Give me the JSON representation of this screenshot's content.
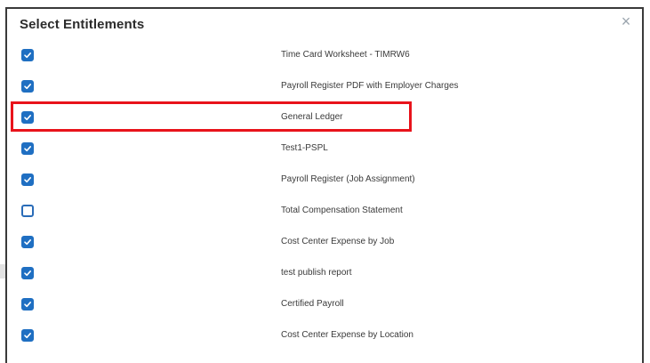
{
  "dialog": {
    "title": "Select Entitlements",
    "close_glyph": "×"
  },
  "entitlements": [
    {
      "label": "Time Card Worksheet - TIMRW6",
      "checked": true
    },
    {
      "label": "Payroll Register PDF with Employer Charges",
      "checked": true
    },
    {
      "label": "General Ledger",
      "checked": true,
      "highlighted": true
    },
    {
      "label": "Test1-PSPL",
      "checked": true
    },
    {
      "label": "Payroll Register (Job Assignment)",
      "checked": true
    },
    {
      "label": "Total Compensation Statement",
      "checked": false
    },
    {
      "label": "Cost Center Expense by Job",
      "checked": true
    },
    {
      "label": "test publish report",
      "checked": true
    },
    {
      "label": "Certified Payroll",
      "checked": true
    },
    {
      "label": "Cost Center Expense by Location",
      "checked": true
    }
  ],
  "colors": {
    "checkbox_checked": "#1f6fc2",
    "highlight_border": "#e8131b",
    "close_icon": "#9aa4ad"
  },
  "icons": {
    "close": "close-icon",
    "checkmark": "checkmark-icon"
  }
}
